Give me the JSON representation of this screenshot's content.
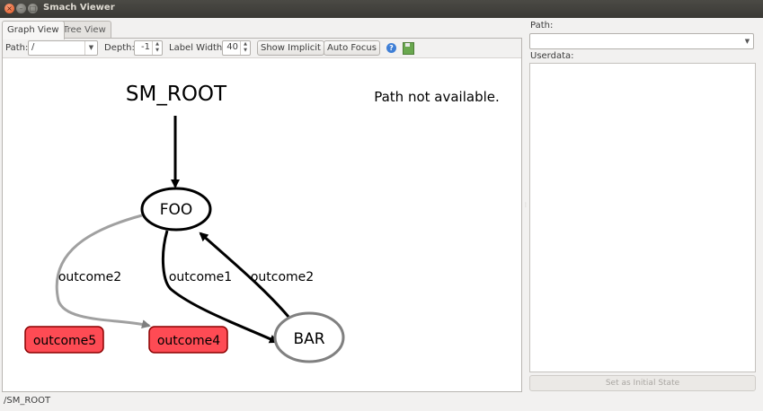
{
  "window": {
    "title": "Smach Viewer",
    "close_glyph": "×",
    "min_glyph": "–",
    "max_glyph": "□"
  },
  "tabs": [
    {
      "label": "Graph View",
      "active": true
    },
    {
      "label": "Tree View",
      "active": false
    }
  ],
  "toolbar": {
    "path_label": "Path:",
    "path_value": "/",
    "depth_label": "Depth:",
    "depth_value": "-1",
    "label_width_label": "Label Width:",
    "label_width_value": "40",
    "show_implicit_label": "Show Implicit",
    "auto_focus_label": "Auto Focus",
    "help_icon": "help-icon",
    "help_glyph": "?",
    "save_icon": "save-image-icon"
  },
  "graph": {
    "root_label": "SM_ROOT",
    "message": "Path not available.",
    "states": [
      {
        "id": "foo",
        "label": "FOO"
      },
      {
        "id": "bar",
        "label": "BAR"
      }
    ],
    "outcomes": [
      {
        "id": "outcome5",
        "label": "outcome5"
      },
      {
        "id": "outcome4",
        "label": "outcome4"
      }
    ],
    "edges": [
      {
        "from": "SM_ROOT",
        "to": "FOO",
        "label": ""
      },
      {
        "from": "FOO",
        "to": "outcome4",
        "label": "outcome2",
        "implicit": true
      },
      {
        "from": "FOO",
        "to": "BAR",
        "label": "outcome1"
      },
      {
        "from": "BAR",
        "to": "FOO",
        "label": "outcome2"
      }
    ],
    "colors": {
      "outcome_fill": "#fe4b54",
      "outcome_border": "#8b0000",
      "implicit_edge": "#a0a0a0",
      "edge": "#000000",
      "bar_border": "#808080"
    }
  },
  "right_panel": {
    "path_label": "Path:",
    "path_value": "",
    "userdata_label": "Userdata:",
    "set_initial_label": "Set as Initial State"
  },
  "status": {
    "text": "/SM_ROOT"
  }
}
